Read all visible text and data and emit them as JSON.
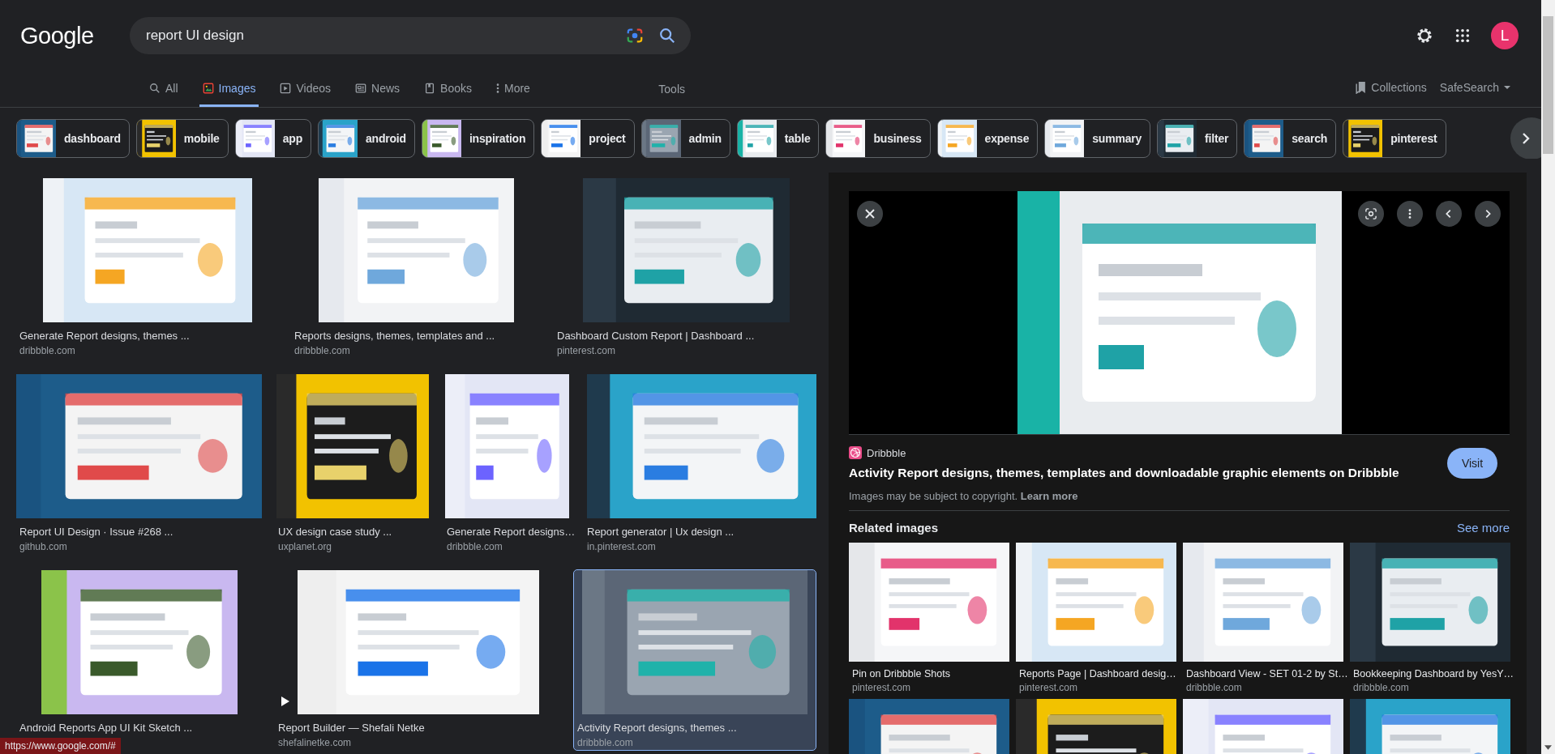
{
  "header": {
    "logo": "Google",
    "search": {
      "value": "report UI design"
    },
    "avatar": "L"
  },
  "tabs": [
    {
      "label": "All",
      "selected": false
    },
    {
      "label": "Images",
      "selected": true
    },
    {
      "label": "Videos",
      "selected": false
    },
    {
      "label": "News",
      "selected": false
    },
    {
      "label": "Books",
      "selected": false
    },
    {
      "label": "More",
      "selected": false
    }
  ],
  "tools": "Tools",
  "collections": "Collections",
  "safesearch": "SafeSearch",
  "chips": [
    {
      "label": "dashboard"
    },
    {
      "label": "mobile"
    },
    {
      "label": "app"
    },
    {
      "label": "android"
    },
    {
      "label": "inspiration"
    },
    {
      "label": "project"
    },
    {
      "label": "admin"
    },
    {
      "label": "table"
    },
    {
      "label": "business"
    },
    {
      "label": "expense"
    },
    {
      "label": "summary"
    },
    {
      "label": "filter"
    },
    {
      "label": "search"
    },
    {
      "label": "pinterest"
    }
  ],
  "results": [
    {
      "title": "Generate Report designs, themes ...",
      "domain": "dribbble.com",
      "selected": false,
      "video": false
    },
    {
      "title": "Reports designs, themes, templates and ...",
      "domain": "dribbble.com",
      "selected": false,
      "video": false
    },
    {
      "title": "Dashboard Custom Report | Dashboard ...",
      "domain": "pinterest.com",
      "selected": false,
      "video": false
    },
    {
      "title": "Report UI Design · Issue #268 ...",
      "domain": "github.com",
      "selected": false,
      "video": false
    },
    {
      "title": "UX design case study ...",
      "domain": "uxplanet.org",
      "selected": false,
      "video": false
    },
    {
      "title": "Generate Report designs…",
      "domain": "dribbble.com",
      "selected": false,
      "video": false
    },
    {
      "title": "Report generator | Ux design ...",
      "domain": "in.pinterest.com",
      "selected": false,
      "video": false
    },
    {
      "title": "Android Reports App UI Kit Sketch ...",
      "selected": false,
      "video": false
    },
    {
      "title": "Report Builder — Shefali Netke",
      "domain": "shefalinetke.com",
      "selected": false,
      "video": true
    },
    {
      "title": "Activity Report designs, themes ...",
      "domain": "dribbble.com",
      "selected": true,
      "video": false
    }
  ],
  "preview": {
    "source": "Dribbble",
    "title": "Activity Report designs, themes, templates and downloadable graphic elements on Dribbble",
    "visit": "Visit",
    "copyright": "Images may be subject to copyright.",
    "learn_more": "Learn more",
    "related_heading": "Related images",
    "see_more": "See more",
    "related": [
      {
        "kind": "captioned",
        "title": "Pin on Dribbble Shots",
        "domain": "pinterest.com"
      },
      {
        "kind": "captioned",
        "title": "Reports Page | Dashboard desig…",
        "domain": "pinterest.com"
      },
      {
        "kind": "captioned",
        "title": "Dashboard View - SET 01-2 by St…",
        "domain": "dribbble.com"
      },
      {
        "kind": "captioned",
        "title": "Bookkeeping Dashboard by YesY…",
        "domain": "dribbble.com"
      },
      {
        "kind": "picture"
      },
      {
        "kind": "picture"
      },
      {
        "kind": "picture"
      },
      {
        "kind": "picture"
      }
    ]
  },
  "status_url": "https://www.google.com/#"
}
